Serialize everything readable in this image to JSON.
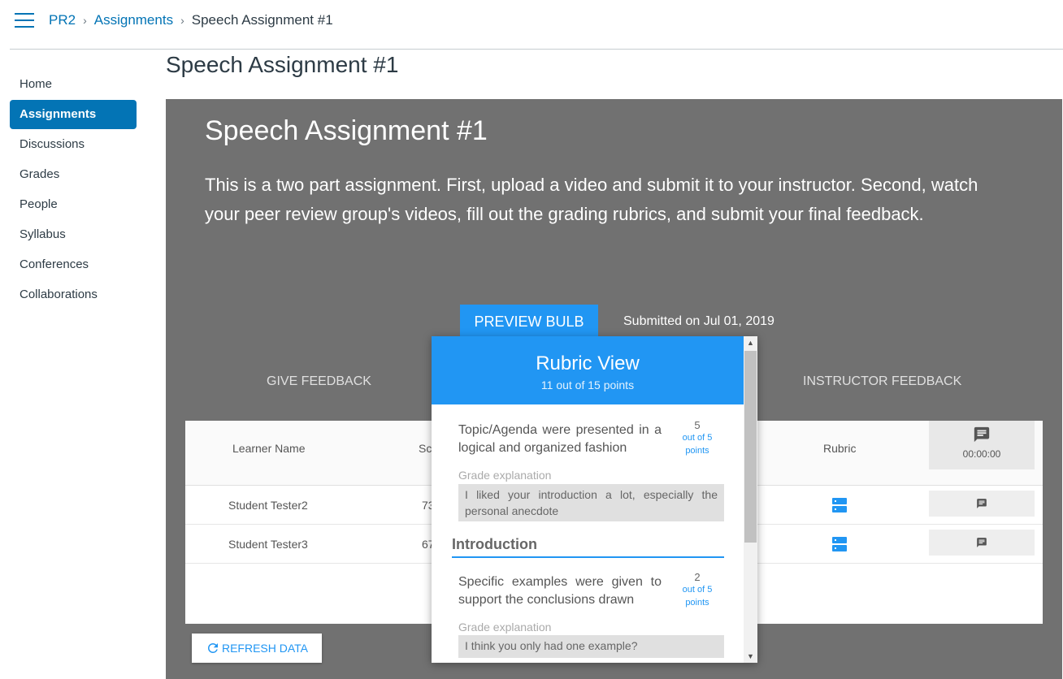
{
  "breadcrumb": {
    "course": "PR2",
    "section": "Assignments",
    "current": "Speech Assignment #1"
  },
  "sidebar": {
    "items": [
      {
        "label": "Home"
      },
      {
        "label": "Assignments"
      },
      {
        "label": "Discussions"
      },
      {
        "label": "Grades"
      },
      {
        "label": "People"
      },
      {
        "label": "Syllabus"
      },
      {
        "label": "Conferences"
      },
      {
        "label": "Collaborations"
      }
    ],
    "active": "Assignments"
  },
  "page": {
    "title": "Speech Assignment #1"
  },
  "panel": {
    "title": "Speech Assignment #1",
    "description": "This is a two part assignment. First, upload a video and submit it to your instructor. Second, watch your peer review group's videos, fill out the grading rubrics, and submit your final feedback.",
    "preview_button": "PREVIEW BULB",
    "submitted": "Submitted on Jul 01, 2019",
    "tab_give": "GIVE FEEDBACK",
    "tab_instructor": "INSTRUCTOR FEEDBACK"
  },
  "table": {
    "headers": {
      "name": "Learner Name",
      "score": "Sc",
      "rubric": "Rubric"
    },
    "time": "00:00:00",
    "rows": [
      {
        "name": "Student Tester2",
        "score": "73"
      },
      {
        "name": "Student Tester3",
        "score": "67"
      }
    ]
  },
  "refresh_label": "REFRESH DATA",
  "popup": {
    "title": "Rubric View",
    "points": "11 out of 15 points",
    "criteria": [
      {
        "text": "Topic/Agenda were presented in a logical and organized fashion",
        "score": "5",
        "out_of": "out of 5",
        "unit": "points",
        "explanation_label": "Grade explanation",
        "explanation": "I liked your introduction a lot, especially the personal anecdote"
      },
      {
        "text": "Specific examples were given to support the conclusions drawn",
        "score": "2",
        "out_of": "out of 5",
        "unit": "points",
        "explanation_label": "Grade explanation",
        "explanation": "I think you only had one example?"
      }
    ],
    "section_title": "Introduction"
  },
  "colors": {
    "accent": "#2196f3",
    "canvas_blue": "#0374b5",
    "panel_gray": "#717171"
  }
}
